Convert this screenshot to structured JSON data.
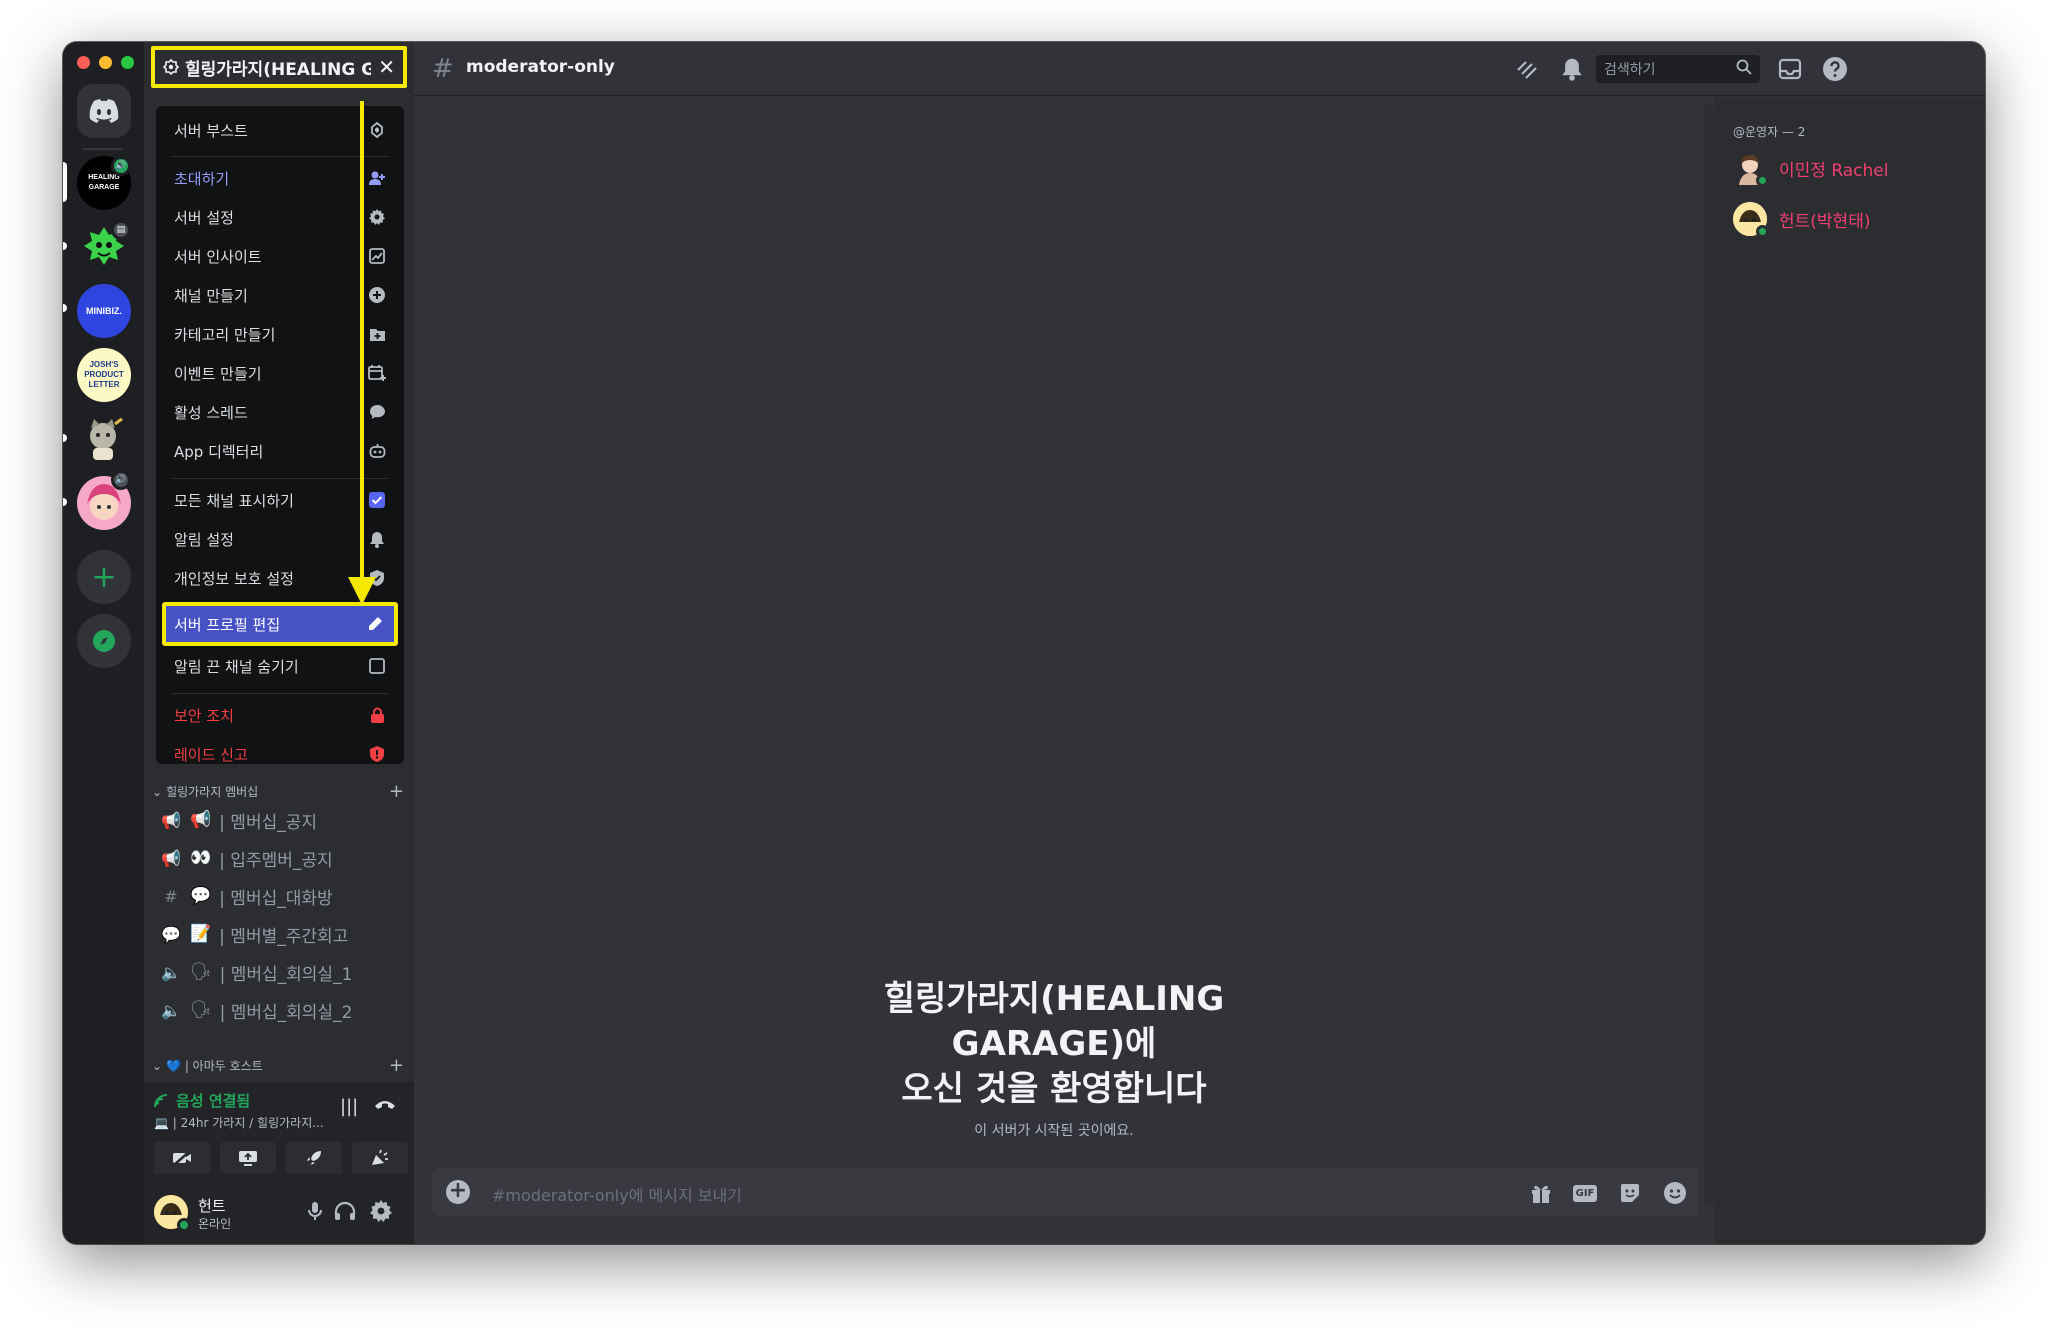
{
  "server": {
    "name": "힐링가라지(HEALING GARAGE)",
    "close_glyph": "✕"
  },
  "menu": {
    "items": [
      {
        "label": "서버 부스트",
        "icon": "boost-icon"
      },
      {
        "label": "초대하기",
        "icon": "add-person-icon"
      },
      {
        "label": "서버 설정",
        "icon": "gear-icon"
      },
      {
        "label": "서버 인사이트",
        "icon": "chart-icon"
      },
      {
        "label": "채널 만들기",
        "icon": "plus-circle-icon"
      },
      {
        "label": "카테고리 만들기",
        "icon": "folder-plus-icon"
      },
      {
        "label": "이벤트 만들기",
        "icon": "calendar-plus-icon"
      },
      {
        "label": "활성 스레드",
        "icon": "thread-icon"
      },
      {
        "label": "App 디렉터리",
        "icon": "robot-icon"
      },
      {
        "label": "모든 채널 표시하기",
        "icon": "checkbox-checked-icon"
      },
      {
        "label": "알림 설정",
        "icon": "bell-icon"
      },
      {
        "label": "개인정보 보호 설정",
        "icon": "shield-icon"
      },
      {
        "label": "서버 프로필 편집",
        "icon": "pencil-icon"
      },
      {
        "label": "알림 끈 채널 숨기기",
        "icon": "checkbox-empty-icon"
      },
      {
        "label": "보안 조치",
        "icon": "lock-icon"
      },
      {
        "label": "레이드 신고",
        "icon": "shield-alert-icon"
      }
    ]
  },
  "categories": [
    {
      "label": "힐링가라지 멤버십",
      "channels": [
        {
          "label": "| 멤버십_공지",
          "emoji": "📢",
          "prefix": "📢"
        },
        {
          "label": "| 입주멤버_공지",
          "emoji": "👀",
          "prefix": "📢"
        },
        {
          "label": "| 멤버십_대화방",
          "emoji": "💬",
          "prefix": "#"
        },
        {
          "label": "| 멤버별_주간회고",
          "emoji": "📝",
          "prefix": "💬"
        },
        {
          "label": "| 멤버십_회의실_1",
          "emoji": "🗣",
          "prefix": "🔈"
        },
        {
          "label": "| 멤버십_회의실_2",
          "emoji": "🗣",
          "prefix": "🔈"
        }
      ]
    },
    {
      "label": "💙 | 아마두 호스트",
      "channels": []
    }
  ],
  "voice": {
    "status": "음성 연결됨",
    "location": "💻 | 24hr 가라지 / 힐링가라지..."
  },
  "user": {
    "name": "헌트",
    "status": "온라인"
  },
  "topbar": {
    "channel": "moderator-only",
    "search_placeholder": "검색하기"
  },
  "chat": {
    "welcome_line1": "힐링가라지(HEALING",
    "welcome_line2": "GARAGE)에",
    "welcome_line3": "오신 것을 환영합니다",
    "welcome_sub": "이 서버가 시작된 곳이에요.",
    "composer_placeholder": "#moderator-only에 메시지 보내기",
    "gif_label": "GIF"
  },
  "members": {
    "role_header": "@운영자 — 2",
    "list": [
      {
        "name": "이민정 Rachel"
      },
      {
        "name": "헌트(박현태)"
      }
    ]
  },
  "rail": {
    "servers": [
      {
        "label": "HEALING GARAGE"
      },
      {
        "label": "MINIBIZ."
      },
      {
        "label": "JOSH'S PRODUCT LETTER"
      }
    ]
  },
  "colors": {
    "highlight": "#f5e900",
    "accent": "#4752c4",
    "danger": "#f23f43",
    "online": "#23a55a"
  }
}
